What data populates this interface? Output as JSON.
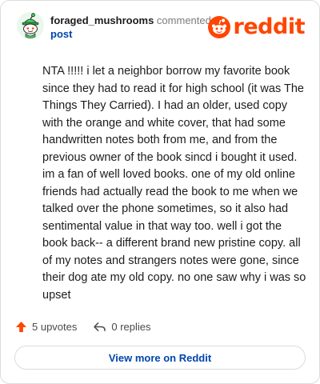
{
  "header": {
    "username": "foraged_mushrooms",
    "action_text": " commented on",
    "post_link": "post",
    "logo_text": "reddit"
  },
  "comment": {
    "body": "NTA !!!!! i let a neighbor borrow my favorite book since they had to read it for high school (it was The Things They Carried). I had an older, used copy with the orange and white cover, that had some handwritten notes both from me, and from the previous owner of the book sincd i bought it used. im a fan of well loved books. one of my old online friends had actually read the book to me when we talked over the phone sometimes, so it also had sentimental value in that way too. well i got the book back-- a different brand new pristine copy. all of my notes and strangers notes were gone, since their dog ate my old copy. no one saw why i was so upset"
  },
  "stats": {
    "upvotes_label": "5 upvotes",
    "replies_label": "0 replies"
  },
  "footer": {
    "view_more_label": "View more on Reddit"
  },
  "colors": {
    "brand": "#ff4500",
    "link": "#0045ac",
    "avatar_green": "#46d160"
  }
}
